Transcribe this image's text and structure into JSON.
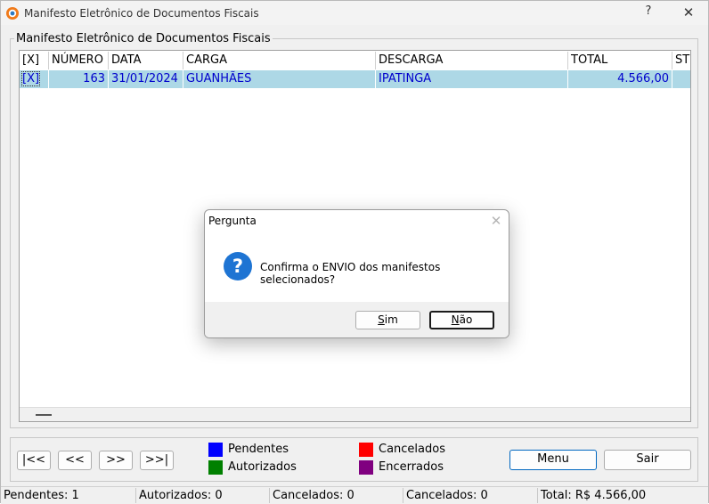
{
  "window": {
    "title": "Manifesto Eletrônico de Documentos Fiscais",
    "help_label": "?",
    "close_label": "✕"
  },
  "group": {
    "title": "Manifesto Eletrônico de Documentos Fiscais"
  },
  "grid": {
    "columns": [
      "[X]",
      "NÚMERO",
      "DATA",
      "CARGA",
      "DESCARGA",
      "TOTAL",
      "ST"
    ],
    "rows": [
      {
        "check": "[X]",
        "numero": "163",
        "data": "31/01/2024",
        "carga": "GUANHÃES",
        "descarga": "IPATINGA",
        "total": "4.566,00",
        "st": ""
      }
    ]
  },
  "nav": {
    "first": "|<<",
    "prev": "<<",
    "next": ">>",
    "last": ">>|"
  },
  "legend": [
    {
      "label": "Pendentes",
      "color": "#0000ff"
    },
    {
      "label": "Autorizados",
      "color": "#008000"
    },
    {
      "label": "Cancelados",
      "color": "#ff0000"
    },
    {
      "label": "Encerrados",
      "color": "#800080"
    }
  ],
  "actions": {
    "menu": "Menu",
    "sair": "Sair"
  },
  "status": [
    "Pendentes: 1",
    "Autorizados: 0",
    "Cancelados: 0",
    "Cancelados: 0",
    "Total: R$ 4.566,00"
  ],
  "dialog": {
    "title": "Pergunta",
    "close": "✕",
    "icon": "question-icon",
    "message": "Confirma o ENVIO dos manifestos selecionados?",
    "yes_prefix": "",
    "yes_accel": "S",
    "yes_rest": "im",
    "no_prefix": "",
    "no_accel": "N",
    "no_rest": "ão"
  }
}
